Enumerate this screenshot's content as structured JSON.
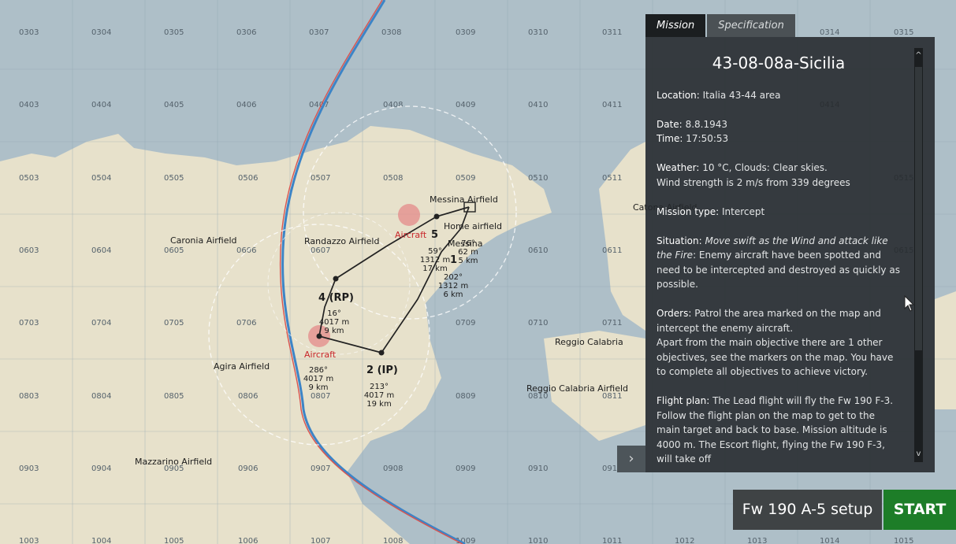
{
  "tabs": {
    "mission": "Mission",
    "specification": "Specification"
  },
  "briefing": {
    "title": "43-08-08a-Sicilia",
    "location_label": "Location:",
    "location": "Italia 43-44 area",
    "date_label": "Date:",
    "date": "8.8.1943",
    "time_label": "Time:",
    "time": "17:50:53",
    "weather_label": "Weather:",
    "weather": "10 °C, Clouds: Clear skies.",
    "wind": "Wind strength is 2 m/s from 339 degrees",
    "mission_type_label": "Mission type:",
    "mission_type": "Intercept",
    "situation_label": "Situation:",
    "situation_em": "Move swift as the Wind and attack like the Fire",
    "situation_text": ": Enemy aircraft have been spotted and need to be intercepted and destroyed as quickly as possible.",
    "orders_label": "Orders:",
    "orders": "Patrol the area marked on the map and intercept the enemy aircraft.",
    "orders_extra": "Apart from the main objective there are 1 other objectives, see the markers on the map. You have to complete all objectives to achieve victory.",
    "flight_plan_label": "Flight plan:",
    "flight_plan": "The Lead flight will fly the Fw 190 F-3. Follow the flight plan on the map to get to the main target and back to base. Mission altitude is 4000 m. The Escort flight, flying the Fw 190 F-3, will take off"
  },
  "buttons": {
    "setup": "Fw 190 A-5 setup",
    "start": "START",
    "expand": "›"
  },
  "scrollbar": {
    "up": "^",
    "down": "v"
  },
  "map": {
    "grid_row_1": [
      "0303",
      "0304",
      "0305",
      "0306",
      "0307",
      "0308",
      "0309",
      "0310",
      "0311",
      "0314",
      "0315"
    ],
    "grid_row_2": [
      "0403",
      "0404",
      "0405",
      "0406",
      "0407",
      "0408",
      "0409",
      "0410",
      "0411",
      "0414"
    ],
    "grid_row_3": [
      "0503",
      "0504",
      "0505",
      "0506",
      "0507",
      "0508",
      "0509",
      "0510",
      "0511",
      "0515"
    ],
    "grid_row_4": [
      "0603",
      "0604",
      "0605",
      "0606",
      "0607",
      "0610",
      "0611",
      "0615"
    ],
    "grid_row_5": [
      "0703",
      "0704",
      "0705",
      "0706",
      "0709",
      "0710",
      "0711"
    ],
    "grid_row_6": [
      "0803",
      "0804",
      "0805",
      "0806",
      "0807",
      "0809",
      "0810",
      "0811"
    ],
    "grid_row_7": [
      "0903",
      "0904",
      "0905",
      "0906",
      "0907",
      "0908",
      "0909",
      "0910",
      "091"
    ],
    "grid_row_8": [
      "1003",
      "1004",
      "1005",
      "1006",
      "1007",
      "1008",
      "1009",
      "1010",
      "1011",
      "1012",
      "1013",
      "1014",
      "1015"
    ],
    "places": {
      "messina_airfield": "Messina Airfield",
      "home_airfield": "Home airfield",
      "messina": "Messina",
      "catona_airfield": "Catona Airfield",
      "caronia_airfield": "Caronia Airfield",
      "randazzo_airfield": "Randazzo Airfield",
      "reggio_calabria": "Reggio Calabria",
      "reggio_calabria_airfield": "Reggio Calabria Airfield",
      "agira_airfield": "Agira Airfield",
      "mazzarino_airfield": "Mazzarino Airfield"
    },
    "waypoints": {
      "wp5": "5",
      "wp4": "4 (RP)",
      "wp2": "2 (IP)",
      "wp1": "1"
    },
    "aircraft_label_1": "Aircraft",
    "aircraft_label_2": "Aircraft",
    "legs": {
      "leg_a": [
        "59°",
        "1312 m",
        "17 km"
      ],
      "leg_b": [
        "76°",
        "62 m",
        "5 km"
      ],
      "leg_c": [
        "202°",
        "1312 m",
        "6 km"
      ],
      "leg_d": [
        "16°",
        "4017 m",
        "9 km"
      ],
      "leg_e": [
        "286°",
        "4017 m",
        "9 km"
      ],
      "leg_f": [
        "213°",
        "4017 m",
        "19 km"
      ]
    },
    "colors": {
      "sea": "#aebfc8",
      "land": "#e7e1cb",
      "route": "#222222",
      "threat": "#c8262a",
      "accent_green": "#1d7d28"
    }
  }
}
